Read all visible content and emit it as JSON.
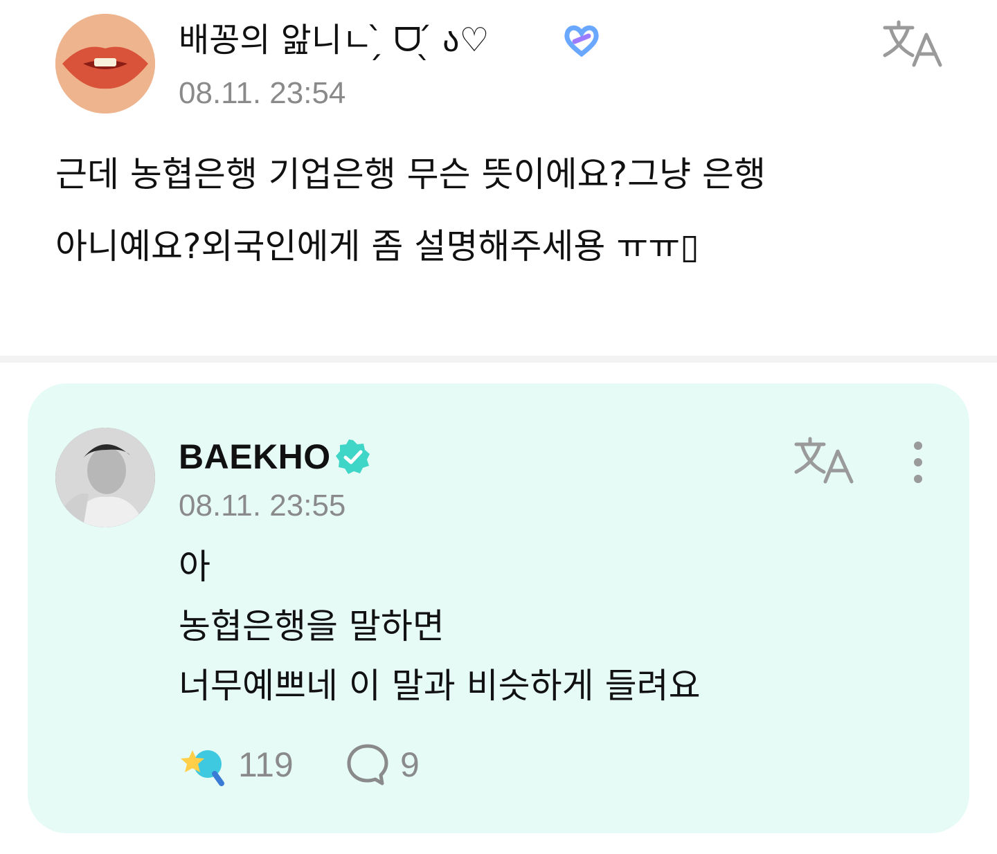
{
  "post": {
    "author": {
      "name": "배꽁의 앒니ㄴ ̗̀ ᗜ ̖́ ა♡",
      "avatar_icon": "lips-avatar",
      "badge_icon": "heart-link-icon"
    },
    "timestamp": "08.11. 23:54",
    "translate_icon": "translate-icon",
    "body_lines": [
      "근데 농협은행 기업은행 무슨 뜻이에요?그냥 은행",
      "아니예요?외국인에게 좀 설명해주세용 ㅠㅠ▯"
    ]
  },
  "reply": {
    "author": {
      "name": "BAEKHO",
      "avatar_icon": "profile-photo-avatar",
      "verified_icon": "verified-badge-icon"
    },
    "timestamp": "08.11. 23:55",
    "translate_icon": "translate-icon",
    "more_icon": "more-options-icon",
    "body_lines": [
      "아",
      "농협은행을 말하면",
      "너무예쁘네 이 말과 비슷하게 들려요"
    ],
    "reactions": {
      "likes": "119",
      "comments": "9"
    }
  },
  "colors": {
    "reply_background": "#e6fbf6",
    "timestamp": "#8a8a8a",
    "verified": "#3fd6c7",
    "icon_gray": "#9a9a9a"
  }
}
